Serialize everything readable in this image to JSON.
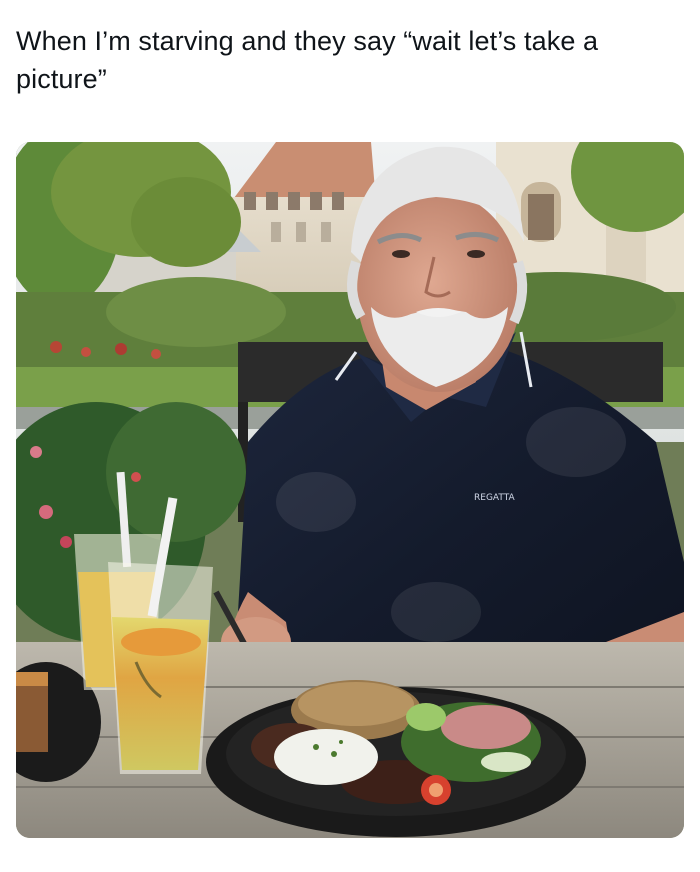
{
  "post": {
    "caption": "When I’m starving and they say “wait let’s take a picture”"
  },
  "photo": {
    "shirt_logo_text": "REGATTA",
    "colors": {
      "sky": "#e9ecef",
      "building": "#e8dfcf",
      "roof": "#c98e72",
      "tree": "#6f8f45",
      "lawn": "#7aa04a",
      "shirt": "#151c2f",
      "skin": "#d9a08a",
      "hair": "#e7e7e7",
      "plate": "#1a1a1a",
      "lemonade": "#d9cf62",
      "table": "#a9a49a"
    }
  }
}
